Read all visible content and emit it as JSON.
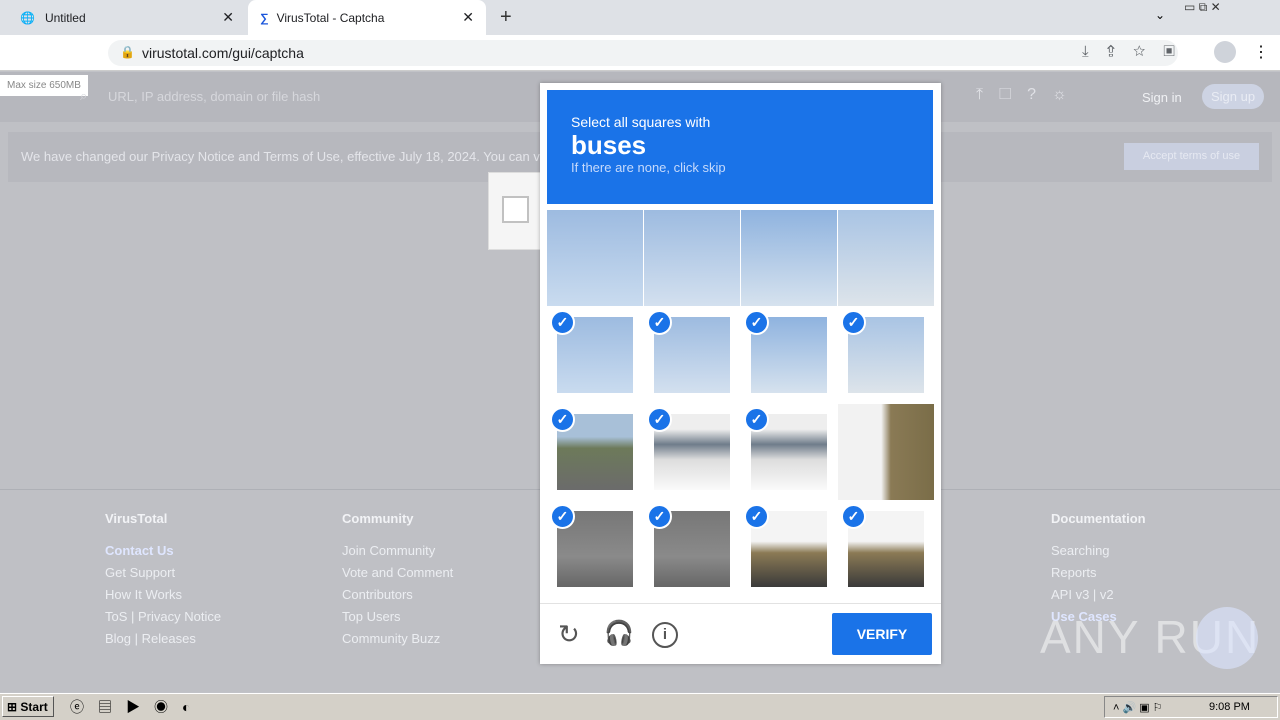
{
  "browser": {
    "tabs": [
      {
        "title": "Untitled"
      },
      {
        "title": "VirusTotal - Captcha"
      }
    ],
    "url": "virustotal.com/gui/captcha"
  },
  "site": {
    "max_size": "Max size 650MB",
    "search_placeholder": "URL, IP address, domain or file hash",
    "sign_in": "Sign in",
    "sign_up": "Sign up",
    "banner_text": "We have changed our Privacy Notice and Terms of Use, effective July 18, 2024. You can v",
    "accept_terms": "Accept terms of use"
  },
  "footer": {
    "columns": [
      {
        "heading": "VirusTotal",
        "links": [
          "Contact Us",
          "Get Support",
          "How It Works",
          "ToS | Privacy Notice",
          "Blog | Releases"
        ]
      },
      {
        "heading": "Community",
        "links": [
          "Join Community",
          "Vote and Comment",
          "Contributors",
          "Top Users",
          "Community Buzz"
        ]
      },
      {
        "heading": "Documentation",
        "links": [
          "Searching",
          "Reports",
          "API v3 | v2",
          "Use Cases"
        ]
      }
    ]
  },
  "captcha": {
    "prompt": "Select all squares with",
    "target": "buses",
    "hint": "If there are none, click skip",
    "verify": "VERIFY",
    "tiles_selected": [
      [
        false,
        false,
        false,
        false
      ],
      [
        true,
        true,
        true,
        true
      ],
      [
        true,
        true,
        true,
        false
      ],
      [
        true,
        true,
        true,
        true
      ]
    ]
  },
  "watermark": "ANY RUN",
  "taskbar": {
    "start": "Start",
    "clock": "9:08 PM"
  }
}
